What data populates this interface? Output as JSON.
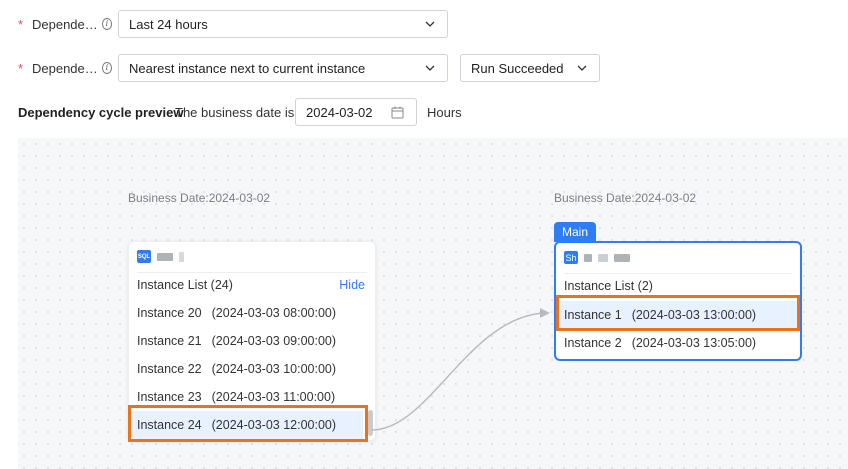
{
  "form": {
    "row1": {
      "required": "*",
      "label": "Depende…",
      "select_value": "Last 24 hours"
    },
    "row2": {
      "required": "*",
      "label": "Depende…",
      "select_value": "Nearest instance next to current instance",
      "status_value": "Run Succeeded"
    }
  },
  "preview": {
    "title": "Dependency cycle preview",
    "business_date_label": "The business date is",
    "date_value": "2024-03-02",
    "unit_label": "Hours"
  },
  "left_node": {
    "business_date": "Business Date:2024-03-02",
    "type_icon": "SQL",
    "list_title": "Instance List (24)",
    "hide_label": "Hide",
    "instances": [
      {
        "name": "Instance 20",
        "time": "(2024-03-03 08:00:00)"
      },
      {
        "name": "Instance 21",
        "time": "(2024-03-03 09:00:00)"
      },
      {
        "name": "Instance 22",
        "time": "(2024-03-03 10:00:00)"
      },
      {
        "name": "Instance 23",
        "time": "(2024-03-03 11:00:00)"
      },
      {
        "name": "Instance 24",
        "time": "(2024-03-03 12:00:00)"
      }
    ]
  },
  "right_node": {
    "business_date": "Business Date:2024-03-02",
    "tag": "Main",
    "type_icon": "Sh",
    "list_title": "Instance List (2)",
    "instances": [
      {
        "name": "Instance 1",
        "time": "(2024-03-03 13:00:00)"
      },
      {
        "name": "Instance 2",
        "time": "(2024-03-03 13:05:00)"
      }
    ]
  },
  "colors": {
    "accent": "#2f7df6",
    "highlight_box": "#e8731a",
    "selected_row": "#e8f1ff",
    "required": "#e34d59"
  },
  "icons": [
    "info-icon",
    "chevron-down-icon",
    "calendar-icon",
    "sql-icon",
    "shell-icon"
  ]
}
